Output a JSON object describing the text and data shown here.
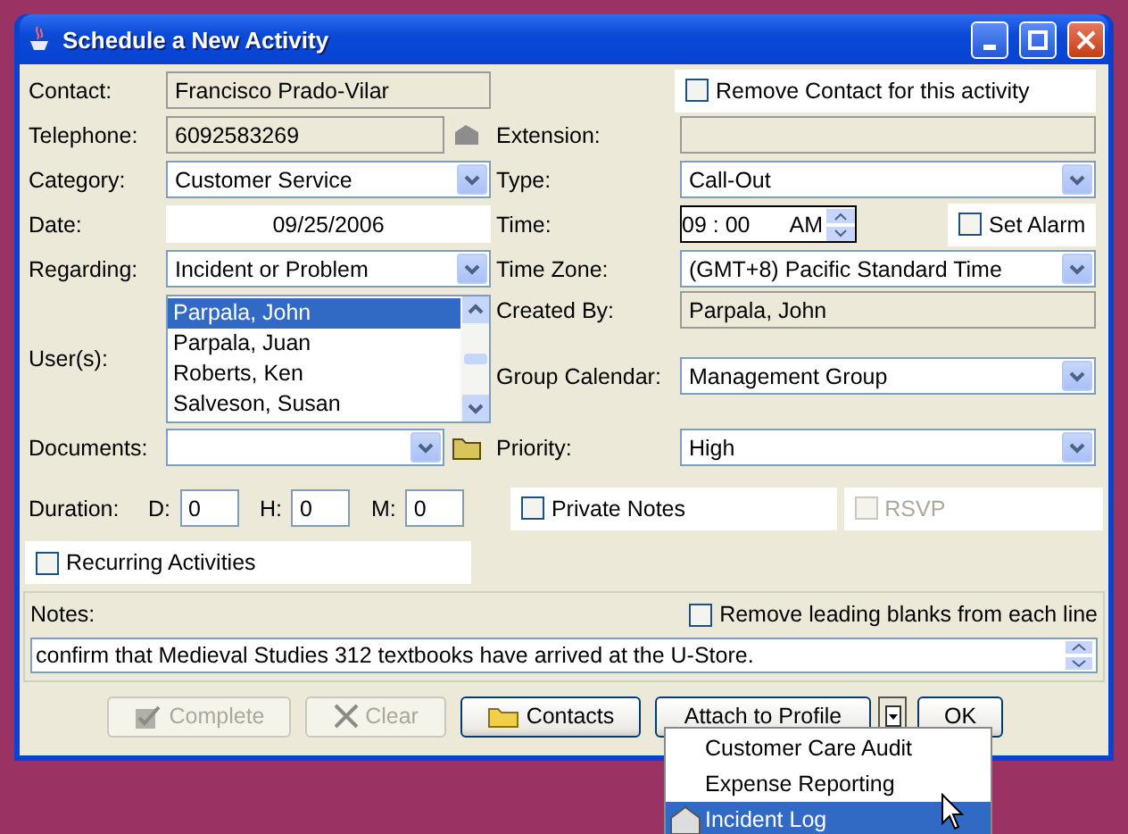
{
  "window": {
    "title": "Schedule a New Activity"
  },
  "contact": {
    "label": "Contact:",
    "value": "Francisco Prado-Vilar"
  },
  "remove_contact": {
    "label": "Remove Contact for this activity",
    "checked": false
  },
  "telephone": {
    "label": "Telephone:",
    "value": "6092583269"
  },
  "extension": {
    "label": "Extension:"
  },
  "category": {
    "label": "Category:",
    "value": "Customer Service"
  },
  "type": {
    "label": "Type:",
    "value": "Call-Out"
  },
  "date": {
    "label": "Date:",
    "value": "09/25/2006"
  },
  "time": {
    "label": "Time:",
    "value": "09 : 00",
    "period": "AM"
  },
  "set_alarm": {
    "label": "Set Alarm",
    "checked": false
  },
  "regarding": {
    "label": "Regarding:",
    "value": "Incident or Problem"
  },
  "time_zone": {
    "label": "Time Zone:",
    "value": "(GMT+8) Pacific Standard Time"
  },
  "users": {
    "label": "User(s):",
    "items": [
      {
        "name": "Parpala, John",
        "selected": true
      },
      {
        "name": "Parpala, Juan",
        "selected": false
      },
      {
        "name": "Roberts, Ken",
        "selected": false
      },
      {
        "name": "Salveson, Susan",
        "selected": false
      }
    ]
  },
  "created_by": {
    "label": "Created By:",
    "value": "Parpala, John"
  },
  "group_calendar": {
    "label": "Group Calendar:",
    "value": "Management Group"
  },
  "documents": {
    "label": "Documents:"
  },
  "priority": {
    "label": "Priority:",
    "value": "High"
  },
  "duration": {
    "label": "Duration:",
    "fields": [
      {
        "label": "D:",
        "value": "0"
      },
      {
        "label": "H:",
        "value": "0"
      },
      {
        "label": "M:",
        "value": "0"
      }
    ]
  },
  "private_notes": {
    "label": "Private Notes",
    "checked": false
  },
  "rsvp": {
    "label": "RSVP",
    "checked": false,
    "disabled": true
  },
  "recurring": {
    "label": "Recurring Activities",
    "checked": false
  },
  "notes": {
    "label": "Notes:",
    "value": "confirm that Medieval Studies 312 textbooks have arrived at the U-Store.",
    "remove_blanks": {
      "label": "Remove leading blanks from each line",
      "checked": false
    }
  },
  "buttons": [
    {
      "label": "Complete",
      "kind": "check",
      "disabled": true
    },
    {
      "label": "Clear",
      "kind": "clear",
      "disabled": true
    },
    {
      "label": "Contacts",
      "kind": "folder",
      "disabled": false
    },
    {
      "label": "Attach to Profile",
      "kind": "split",
      "disabled": false
    },
    {
      "label": "OK",
      "kind": "plain",
      "disabled": false
    }
  ],
  "menu": {
    "items": [
      {
        "label": "Customer Care Audit",
        "selected": false
      },
      {
        "label": "Expense Reporting",
        "selected": false
      },
      {
        "label": "Incident Log",
        "selected": true
      }
    ]
  }
}
